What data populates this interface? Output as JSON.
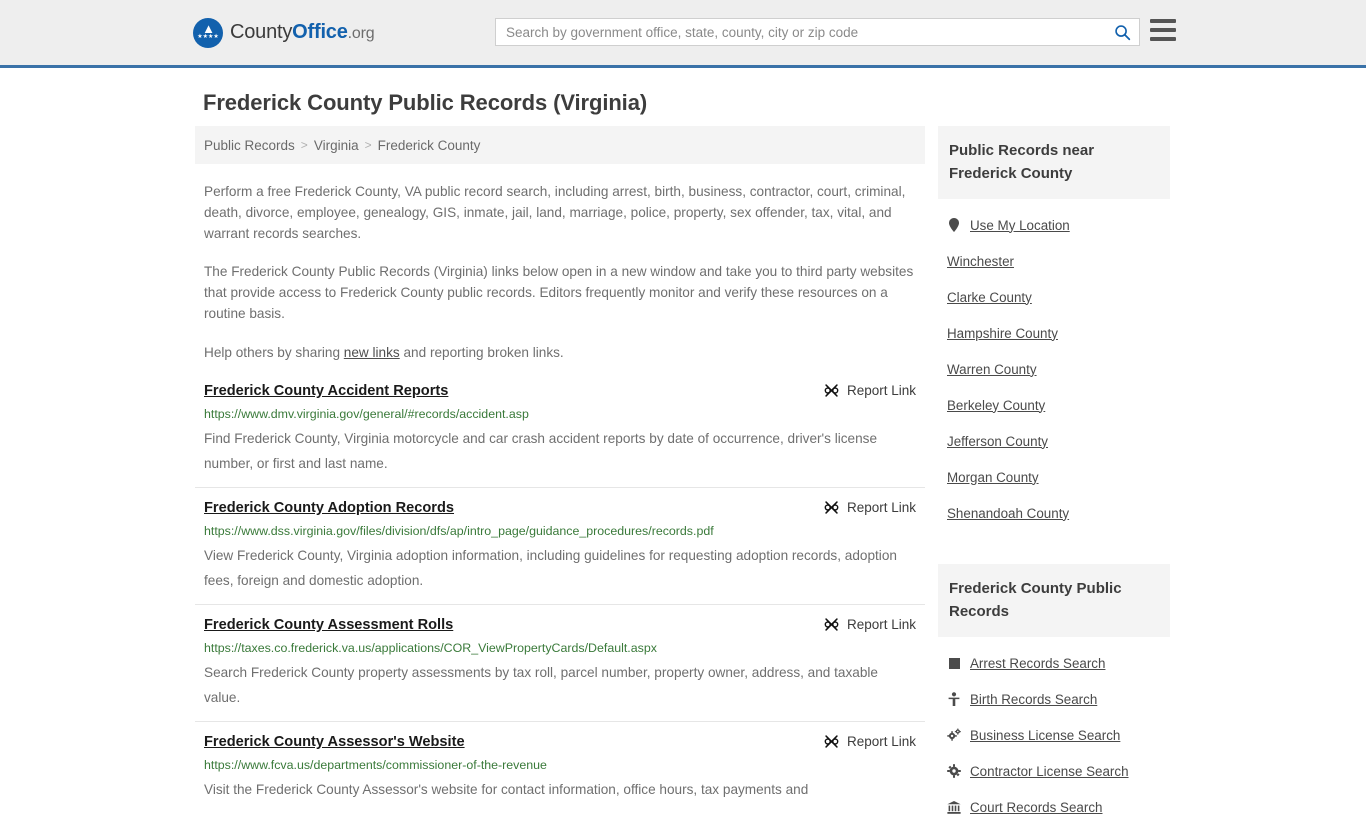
{
  "header": {
    "logo": {
      "part1": "County",
      "part2": "Office",
      "part3": ".org",
      "icon": "eagle-seal-icon"
    },
    "search": {
      "placeholder": "Search by government office, state, county, city or zip code",
      "value": ""
    },
    "search_button_label": "Search",
    "menu_button_label": "Menu",
    "accent_color": "#1261ad",
    "border_color": "#3a72a8"
  },
  "page": {
    "title": "Frederick County Public Records (Virginia)"
  },
  "breadcrumb": {
    "items": [
      {
        "label": "Public Records",
        "current": false
      },
      {
        "label": "Virginia",
        "current": false
      },
      {
        "label": "Frederick County",
        "current": true
      }
    ],
    "separator": ">"
  },
  "intro": {
    "paragraph1": "Perform a free Frederick County, VA public record search, including arrest, birth, business, contractor, court, criminal, death, divorce, employee, genealogy, GIS, inmate, jail, land, marriage, police, property, sex offender, tax, vital, and warrant records searches.",
    "paragraph2": "The Frederick County Public Records (Virginia) links below open in a new window and take you to third party websites that provide access to Frederick County public records. Editors frequently monitor and verify these resources on a routine basis.",
    "share_prefix": "Help others by sharing ",
    "share_link": "new links",
    "share_suffix": " and reporting broken links."
  },
  "results": {
    "report_link_label": "Report Link",
    "report_link_icon": "broken-link-icon",
    "items": [
      {
        "title": "Frederick County Accident Reports",
        "url": "https://www.dmv.virginia.gov/general/#records/accident.asp",
        "description": "Find Frederick County, Virginia motorcycle and car crash accident reports by date of occurrence, driver's license number, or first and last name."
      },
      {
        "title": "Frederick County Adoption Records",
        "url": "https://www.dss.virginia.gov/files/division/dfs/ap/intro_page/guidance_procedures/records.pdf",
        "description": "View Frederick County, Virginia adoption information, including guidelines for requesting adoption records, adoption fees, foreign and domestic adoption."
      },
      {
        "title": "Frederick County Assessment Rolls",
        "url": "https://taxes.co.frederick.va.us/applications/COR_ViewPropertyCards/Default.aspx",
        "description": "Search Frederick County property assessments by tax roll, parcel number, property owner, address, and taxable value."
      },
      {
        "title": "Frederick County Assessor's Website",
        "url": "https://www.fcva.us/departments/commissioner-of-the-revenue",
        "description": "Visit the Frederick County Assessor's website for contact information, office hours, tax payments and"
      }
    ]
  },
  "sidebar": {
    "nearby": {
      "heading": "Public Records near Frederick County",
      "items": [
        {
          "label": "Use My Location",
          "icon": "map-pin-icon"
        },
        {
          "label": "Winchester",
          "icon": ""
        },
        {
          "label": "Clarke County",
          "icon": ""
        },
        {
          "label": "Hampshire County",
          "icon": ""
        },
        {
          "label": "Warren County",
          "icon": ""
        },
        {
          "label": "Berkeley County",
          "icon": ""
        },
        {
          "label": "Jefferson County",
          "icon": ""
        },
        {
          "label": "Morgan County",
          "icon": ""
        },
        {
          "label": "Shenandoah County",
          "icon": ""
        }
      ]
    },
    "records": {
      "heading": "Frederick County Public Records",
      "items": [
        {
          "label": "Arrest Records Search",
          "icon": "square-icon"
        },
        {
          "label": "Birth Records Search",
          "icon": "person-icon"
        },
        {
          "label": "Business License Search",
          "icon": "gears-icon"
        },
        {
          "label": "Contractor License Search",
          "icon": "gear-icon"
        },
        {
          "label": "Court Records Search",
          "icon": "courthouse-icon"
        }
      ]
    }
  }
}
